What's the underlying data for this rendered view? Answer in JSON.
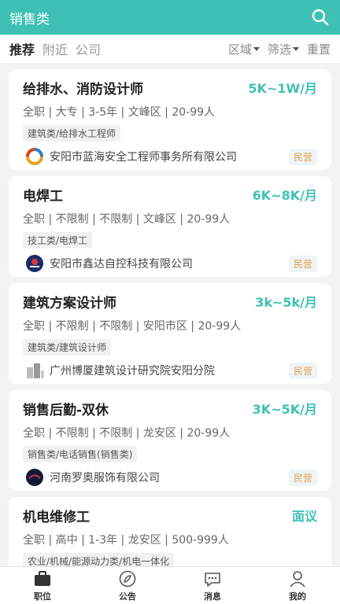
{
  "header": {
    "title": "销售类",
    "search_icon": "search-icon"
  },
  "filter_bar": {
    "tabs": [
      {
        "label": "推荐",
        "active": true
      },
      {
        "label": "附近",
        "active": false
      },
      {
        "label": "公司",
        "active": false
      }
    ],
    "area_label": "区域",
    "filter_label": "筛选",
    "reset_label": "重置"
  },
  "jobs": [
    {
      "title": "给排水、消防设计师",
      "salary": "5K~1W/月",
      "meta": "全职 | 大专 | 3-5年 | 文峰区 | 20-99人",
      "tag": "建筑类/给排水工程师",
      "company": "安阳市蓝海安全工程师事务所有限公司",
      "badge": "民营",
      "logo": "ring-logo"
    },
    {
      "title": "电焊工",
      "salary": "6K~8K/月",
      "meta": "全职 | 不限制 | 不限制 | 文峰区 | 20-99人",
      "tag": "技工类/电焊工",
      "company": "安阳市鑫达自控科技有限公司",
      "badge": "民营",
      "logo": "dark-logo"
    },
    {
      "title": "建筑方案设计师",
      "salary": "3k~5k/月",
      "meta": "全职 | 不限制 | 不限制 | 安阳市区 | 20-99人",
      "tag": "建筑类/建筑设计师",
      "company": "广州博厦建筑设计研究院安阳分院",
      "badge": "民营",
      "logo": "building-logo"
    },
    {
      "title": "销售后勤-双休",
      "salary": "3K~5K/月",
      "meta": "全职 | 不限制 | 不限制 | 龙安区 | 20-99人",
      "tag": "销售类/电话销售(销售类)",
      "company": "河南罗奥服饰有限公司",
      "badge": "民营",
      "logo": "dark-logo"
    },
    {
      "title": "机电维修工",
      "salary": "面议",
      "meta": "全职 | 高中 | 1-3年 | 龙安区 | 500-999人",
      "tag": "农业/机械/能源动力类/机电一体化",
      "company": "",
      "badge": "",
      "logo": ""
    }
  ],
  "bottom_nav": [
    {
      "label": "职位",
      "icon": "briefcase-icon"
    },
    {
      "label": "公告",
      "icon": "compass-icon"
    },
    {
      "label": "消息",
      "icon": "chat-icon"
    },
    {
      "label": "我的",
      "icon": "user-icon"
    }
  ],
  "colors": {
    "accent": "#3ec1b4",
    "badge_text": "#e0a24a"
  }
}
